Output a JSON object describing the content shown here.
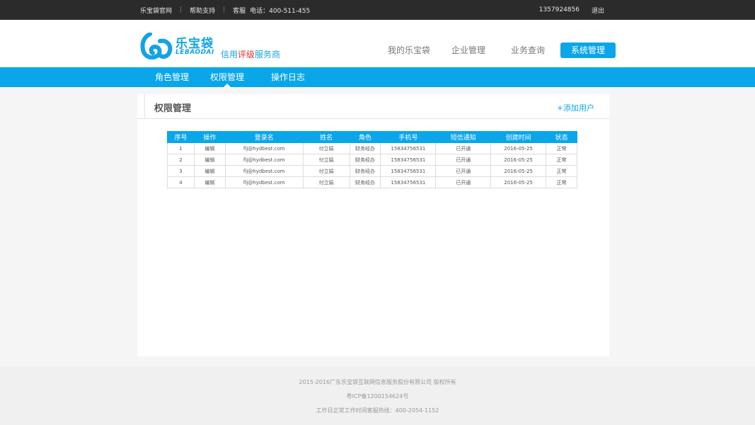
{
  "topbar": {
    "links": [
      "乐宝袋官网",
      "帮助支持"
    ],
    "service_label": "客服",
    "phone_label": "电话：400-511-455",
    "user_phone": "13579248​56",
    "logout": "退出"
  },
  "logo": {
    "cn": "乐宝袋",
    "en": "LEBAODAI",
    "slogan_pre": "信用",
    "slogan_hl": "评级",
    "slogan_post": "服务商",
    "accent_color": "#12a3e6",
    "highlight_color": "#e4322b"
  },
  "mainnav": {
    "items": [
      "我的乐宝袋",
      "企业管理",
      "业务查询",
      "系统管理"
    ],
    "active": "系统管理"
  },
  "subnav": {
    "tabs": [
      "角色管理",
      "权限管理",
      "操作日志"
    ],
    "active": "权限管理"
  },
  "panel": {
    "title": "权限管理",
    "add_user": "+添加用户"
  },
  "table": {
    "columns": [
      "序号",
      "操作",
      "登录名",
      "姓名",
      "角色",
      "手机号",
      "短信通知",
      "创建时间",
      "状态"
    ],
    "rows": [
      [
        "1",
        "编辑",
        "flj@hydbest.com",
        "付立娟",
        "财务经办",
        "15834756531",
        "已开通",
        "2016-05-25",
        "正常"
      ],
      [
        "2",
        "编辑",
        "flj@hydbest.com",
        "付立娟",
        "财务经办",
        "15834756531",
        "已开通",
        "2016-05-25",
        "正常"
      ],
      [
        "3",
        "编辑",
        "flj@hydbest.com",
        "付立娟",
        "财务经办",
        "15834756531",
        "已开通",
        "2016-05-25",
        "正常"
      ],
      [
        "4",
        "编辑",
        "flj@hydbest.com",
        "付立娟",
        "财务经办",
        "15834756531",
        "已开通",
        "2016-05-25",
        "正常"
      ]
    ]
  },
  "footer": {
    "copyright": "2015-2016广东乐宝袋互联网信息服务股份有限公司 版权所有",
    "icp": "粤ICP备1200154624号",
    "hotline": "工作日正常工作时间客服热线：400-2054-1152"
  },
  "colors": {
    "topbar_bg": "#2b2b2b",
    "primary": "#0aa6ea"
  }
}
